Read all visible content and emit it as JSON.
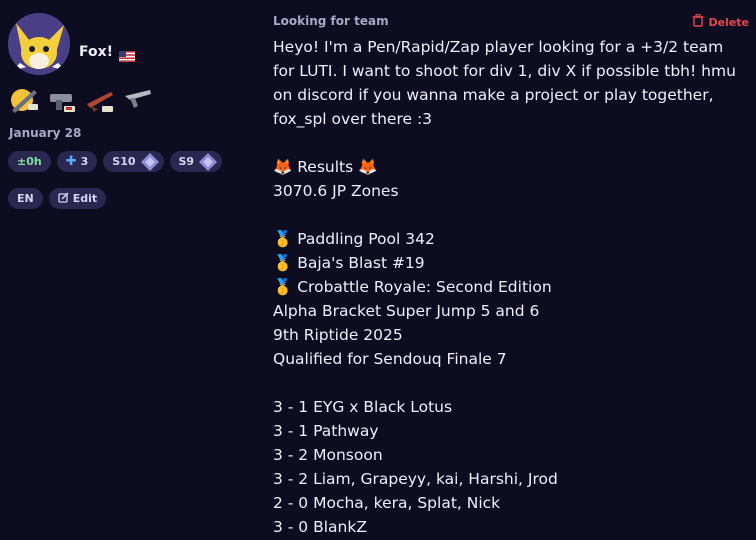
{
  "profile": {
    "name": "Fox!",
    "country_flag": "us-flag-icon",
    "date": "January 28",
    "badges": {
      "plus_hours": "±0h",
      "plus_tier": "3",
      "season_a": "S10",
      "season_b": "S9"
    },
    "language": "EN",
    "edit_label": "Edit"
  },
  "post": {
    "heading": "Looking for team",
    "delete_label": "Delete",
    "lines": [
      "Heyo! I'm a Pen/Rapid/Zap player looking for a +3/2 team",
      "for LUTI. I want to shoot for div 1, div X if possible tbh! hmu",
      "on discord if you wanna make a project or play together,",
      "fox_spl over there :3",
      "",
      "🦊 Results 🦊",
      "3070.6 JP Zones",
      "",
      "🥇 Paddling Pool 342",
      "🥇 Baja's Blast #19",
      "🥇 Crobattle Royale: Second Edition",
      "Alpha Bracket Super Jump 5 and 6",
      "9th Riptide 2025",
      "Qualified for Sendouq Finale 7",
      "",
      "3 - 1 EYG x Black Lotus",
      "3 - 1 Pathway",
      "3 - 2 Monsoon",
      "3 - 2 Liam, Grapeyy, kai, Harshi, Jrod",
      "2 - 0 Mocha, kera, Splat, Nick",
      "3 - 0 BlankZ"
    ]
  },
  "colors": {
    "background": "#0d0c21",
    "pill": "#2a2850",
    "muted": "#a9a6c9",
    "danger": "#e5484d",
    "accent_green": "#7ee0a0"
  }
}
